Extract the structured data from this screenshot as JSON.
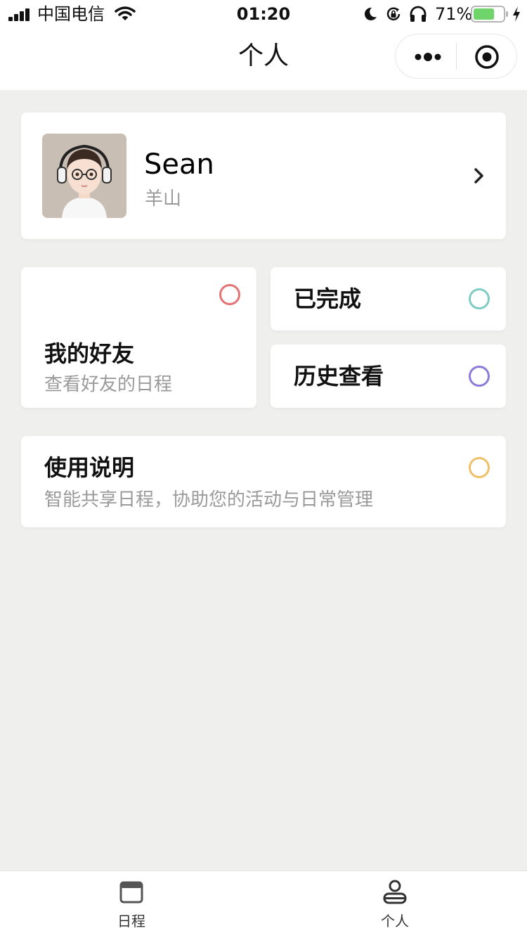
{
  "status_bar": {
    "carrier": "中国电信",
    "time": "01:20",
    "battery_percent": "71%",
    "battery_level": 0.71,
    "icons": [
      "signal-icon",
      "wifi-icon",
      "moon-icon",
      "rotation-lock-icon",
      "headphones-icon",
      "battery-icon",
      "charging-icon"
    ]
  },
  "nav": {
    "title": "个人",
    "icons": [
      "more-dots-icon",
      "target-icon"
    ]
  },
  "profile": {
    "name": "Sean",
    "subtitle": "羊山",
    "icon": "chevron-right-icon"
  },
  "cards": {
    "friends": {
      "title": "我的好友",
      "subtitle": "查看好友的日程",
      "ring_color": "#e57373"
    },
    "completed": {
      "title": "已完成",
      "ring_color": "#80cbc4"
    },
    "history": {
      "title": "历史查看",
      "ring_color": "#8e7ad9"
    },
    "guide": {
      "title": "使用说明",
      "subtitle": "智能共享日程，协助您的活动与日常管理",
      "ring_color": "#f0c069"
    }
  },
  "tab_bar": {
    "tabs": [
      {
        "label": "日程",
        "icon": "calendar-icon"
      },
      {
        "label": "个人",
        "icon": "person-icon"
      }
    ]
  },
  "colors": {
    "background": "#efefed",
    "card": "#ffffff",
    "subtext": "#9a9a9a"
  }
}
